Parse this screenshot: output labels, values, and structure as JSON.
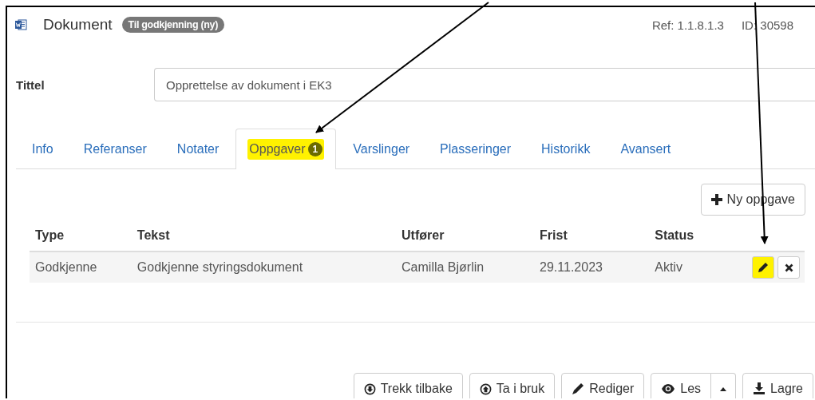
{
  "window": {
    "title": "Dokument",
    "status_badge": "Til godkjenning (ny)",
    "ref": "Ref: 1.1.8.1.3",
    "id": "ID: 30598"
  },
  "title_field": {
    "label": "Tittel",
    "value": "Opprettelse av dokument i EK3"
  },
  "tabs": [
    {
      "label": "Info",
      "selected": false,
      "highlighted": false
    },
    {
      "label": "Referanser",
      "selected": false,
      "highlighted": false
    },
    {
      "label": "Notater",
      "selected": false,
      "highlighted": false
    },
    {
      "label": "Oppgaver",
      "count": "1",
      "selected": true,
      "highlighted": true
    },
    {
      "label": "Varslinger",
      "selected": false,
      "highlighted": false
    },
    {
      "label": "Plasseringer",
      "selected": false,
      "highlighted": false
    },
    {
      "label": "Historikk",
      "selected": false,
      "highlighted": false
    },
    {
      "label": "Avansert",
      "selected": false,
      "highlighted": false
    }
  ],
  "new_task_button": "Ny oppgave",
  "table": {
    "columns": [
      "Type",
      "Tekst",
      "Utfører",
      "Frist",
      "Status"
    ],
    "rows": [
      {
        "cells": [
          "Godkjenne",
          "Godkjenne styringsdokument",
          "Camilla Bjørlin",
          "29.11.2023",
          "Aktiv"
        ],
        "edit_highlighted": true
      }
    ]
  },
  "actions": [
    {
      "label": "Trekk tilbake",
      "kind": "withdraw"
    },
    {
      "label": "Ta i bruk",
      "kind": "publish"
    },
    {
      "label": "Rediger",
      "kind": "edit"
    },
    {
      "label": "Les",
      "kind": "read",
      "dropdown": true
    },
    {
      "label": "Lagre",
      "kind": "save"
    }
  ],
  "annotations": [
    {
      "kind": "arrow"
    },
    {
      "kind": "arrow"
    }
  ]
}
